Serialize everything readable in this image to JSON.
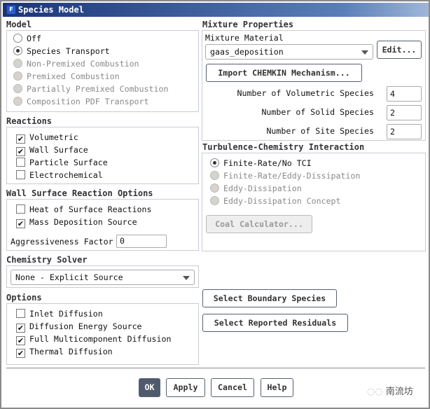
{
  "window": {
    "title": "Species Model",
    "icon": "F"
  },
  "model": {
    "heading": "Model",
    "options": [
      {
        "label": "Off",
        "selected": false,
        "enabled": true
      },
      {
        "label": "Species Transport",
        "selected": true,
        "enabled": true
      },
      {
        "label": "Non-Premixed Combustion",
        "selected": false,
        "enabled": false
      },
      {
        "label": "Premixed Combustion",
        "selected": false,
        "enabled": false
      },
      {
        "label": "Partially Premixed Combustion",
        "selected": false,
        "enabled": false
      },
      {
        "label": "Composition PDF Transport",
        "selected": false,
        "enabled": false
      }
    ]
  },
  "reactions": {
    "heading": "Reactions",
    "items": [
      {
        "label": "Volumetric",
        "checked": true
      },
      {
        "label": "Wall Surface",
        "checked": true
      },
      {
        "label": "Particle Surface",
        "checked": false
      },
      {
        "label": "Electrochemical",
        "checked": false
      }
    ]
  },
  "wall_surface": {
    "heading": "Wall Surface Reaction Options",
    "items": [
      {
        "label": "Heat of Surface Reactions",
        "checked": false
      },
      {
        "label": "Mass Deposition Source",
        "checked": true
      }
    ],
    "aggressiveness_label": "Aggressiveness Factor",
    "aggressiveness_value": "0"
  },
  "chemistry_solver": {
    "heading": "Chemistry Solver",
    "value": "None - Explicit Source"
  },
  "options": {
    "heading": "Options",
    "items": [
      {
        "label": "Inlet Diffusion",
        "checked": false
      },
      {
        "label": "Diffusion Energy Source",
        "checked": true
      },
      {
        "label": "Full Multicomponent Diffusion",
        "checked": true
      },
      {
        "label": "Thermal Diffusion",
        "checked": true
      }
    ]
  },
  "mixture": {
    "heading": "Mixture Properties",
    "material_label": "Mixture Material",
    "material_value": "gaas_deposition",
    "edit": "Edit...",
    "import": "Import CHEMKIN Mechanism...",
    "vol_label": "Number of Volumetric Species",
    "vol_value": "4",
    "solid_label": "Number of Solid Species",
    "solid_value": "2",
    "site_label": "Number of Site Species",
    "site_value": "2"
  },
  "tci": {
    "heading": "Turbulence-Chemistry Interaction",
    "options": [
      {
        "label": "Finite-Rate/No TCI",
        "selected": true,
        "enabled": true
      },
      {
        "label": "Finite-Rate/Eddy-Dissipation",
        "selected": false,
        "enabled": false
      },
      {
        "label": "Eddy-Dissipation",
        "selected": false,
        "enabled": false
      },
      {
        "label": "Eddy-Dissipation Concept",
        "selected": false,
        "enabled": false
      }
    ],
    "coal": "Coal Calculator..."
  },
  "buttons": {
    "boundary": "Select Boundary Species",
    "residuals": "Select Reported Residuals",
    "ok": "OK",
    "apply": "Apply",
    "cancel": "Cancel",
    "help": "Help"
  },
  "watermark": "南流坊"
}
